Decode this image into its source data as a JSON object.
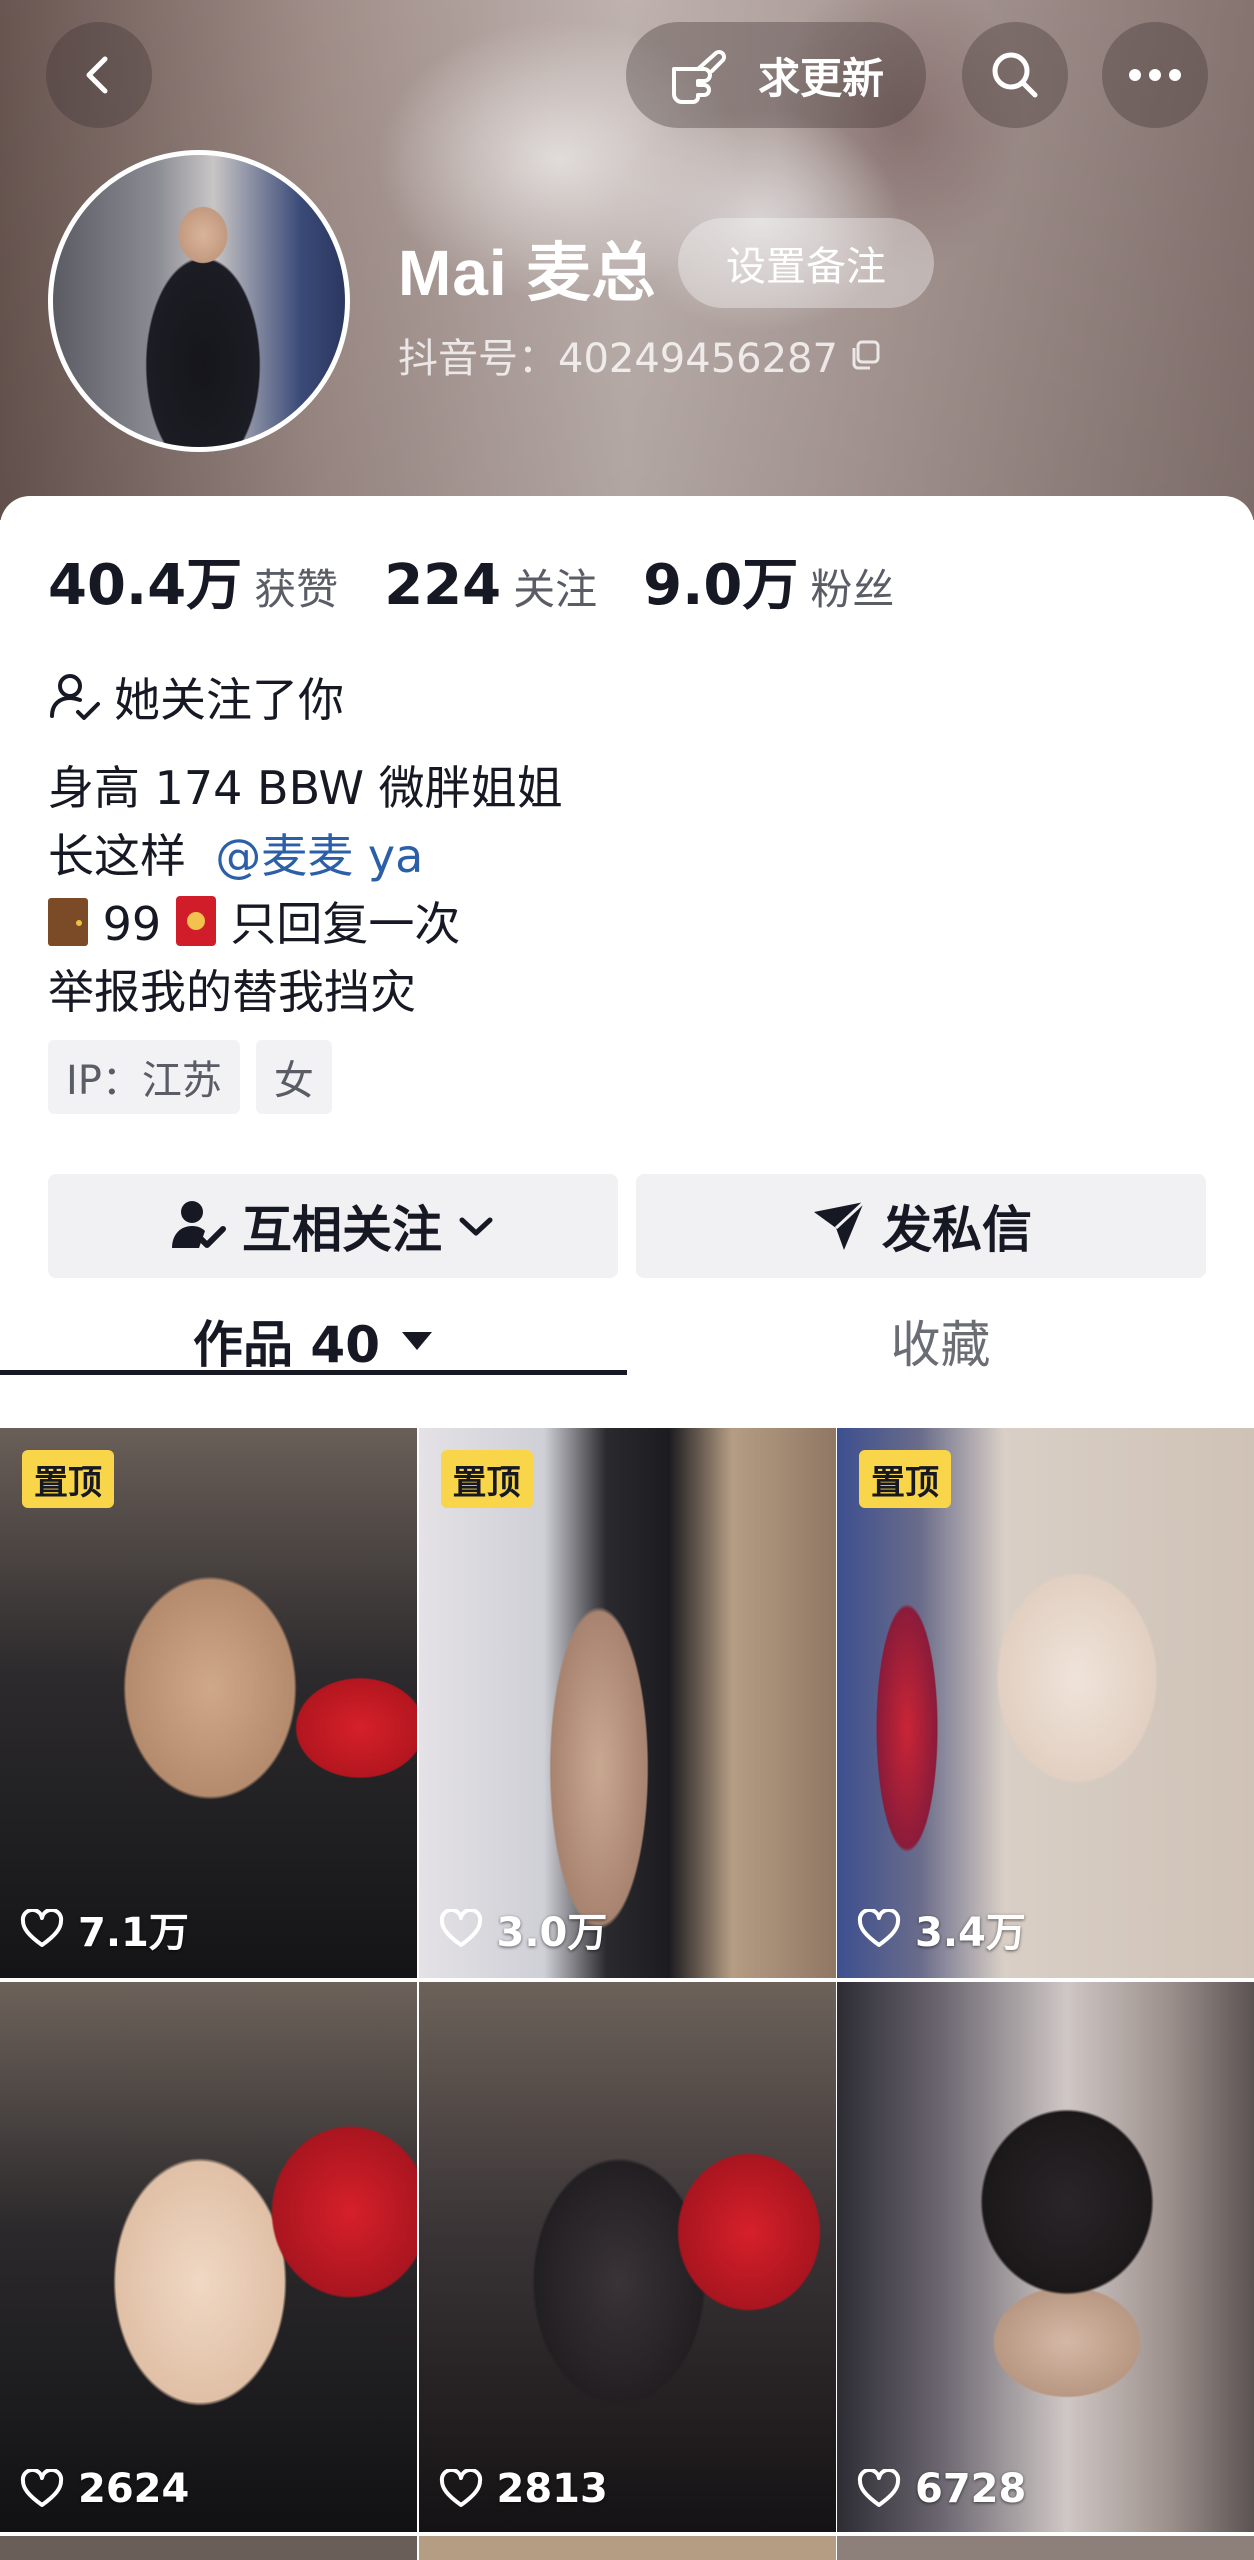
{
  "header": {
    "back_icon": "chevron-left-icon",
    "request_update_label": "求更新",
    "request_update_icon": "pointing-hand-icon",
    "search_icon": "search-icon",
    "more_icon": "more-dots-icon"
  },
  "profile": {
    "nickname": "Mai 麦总",
    "set_remark_label": "设置备注",
    "douyin_id": "抖音号：40249456287",
    "copy_icon": "copy-icon"
  },
  "stats": [
    {
      "value": "40.4万",
      "label": "获赞"
    },
    {
      "value": "224",
      "label": "关注"
    },
    {
      "value": "9.0万",
      "label": "粉丝"
    }
  ],
  "relation": {
    "text": "她关注了你",
    "icon": "person-check-icon"
  },
  "bio": {
    "line1": "身高 174 BBW 微胖姐姐",
    "line2_prefix": "长这样",
    "line2_mention": "@麦麦 ya",
    "line3_number": "99",
    "line3_text": "只回复一次",
    "line4": "举报我的替我挡灾"
  },
  "tags": [
    "IP：江苏",
    "女"
  ],
  "actions": {
    "follow_label": "互相关注",
    "message_label": "发私信"
  },
  "tabs": {
    "works_label": "作品 40",
    "favorites_label": "收藏"
  },
  "pin_label": "置顶",
  "videos": [
    {
      "likes": "7.1万",
      "pinned": true
    },
    {
      "likes": "3.0万",
      "pinned": true
    },
    {
      "likes": "3.4万",
      "pinned": true
    },
    {
      "likes": "2624",
      "pinned": false
    },
    {
      "likes": "2813",
      "pinned": false
    },
    {
      "likes": "6728",
      "pinned": false
    }
  ],
  "colors": {
    "mention": "#2b5fa8",
    "pin_badge": "#f8d549",
    "text_primary": "#161823"
  }
}
